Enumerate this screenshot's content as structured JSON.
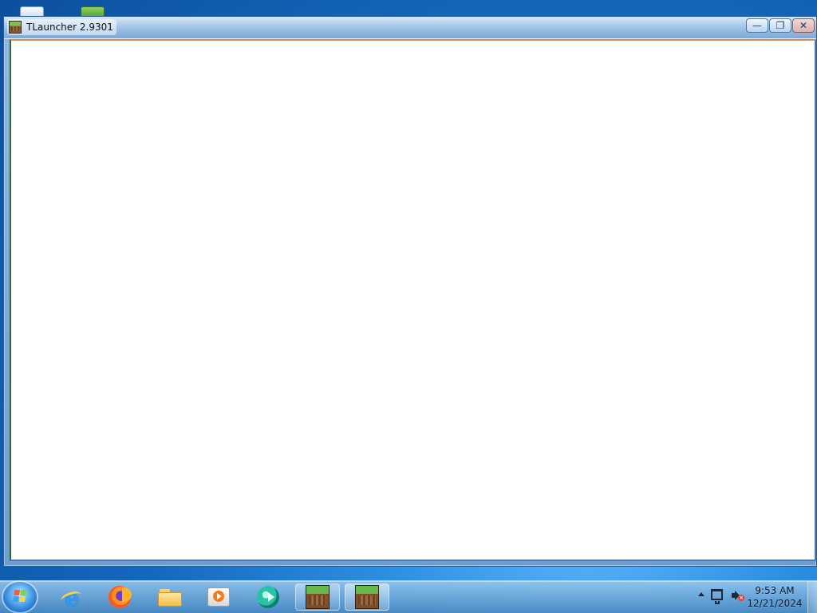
{
  "window": {
    "title": "TLauncher 2.9301"
  },
  "taskbar": {
    "clock": {
      "time": "9:53 AM",
      "date": "12/21/2024"
    }
  }
}
